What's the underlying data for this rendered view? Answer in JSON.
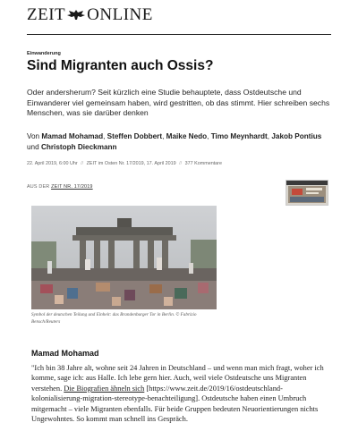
{
  "header": {
    "logo_left": "ZEIT",
    "logo_right": "ONLINE"
  },
  "article": {
    "kicker": "Einwanderung",
    "title": "Sind Migranten auch Ossis?",
    "intro": "Oder andersherum? Seit kürzlich eine Studie behauptete, dass Ostdeutsche und Einwanderer viel gemeinsam haben, wird gestritten, ob das stimmt. Hier schreiben sechs Menschen, was sie darüber denken",
    "authors_prefix": "Von ",
    "authors": [
      "Mamad Mohamad",
      "Steffen Dobbert",
      "Maike Nedo",
      "Timo Meynhardt",
      "Jakob Pontius",
      "Christoph Dieckmann"
    ],
    "authors_sep": ", ",
    "authors_and": " und ",
    "meta": {
      "date": "22. April 2019, 6:00 Uhr",
      "separator": "//",
      "source": "ZEIT im Osten Nr. 17/2019, 17. April 2019",
      "comments": "377 Kommentare"
    },
    "issue": {
      "prefix": "AUS DER",
      "link": "ZEIT NR. 17/2019"
    },
    "image_caption": "Symbol der deutschen Teilung und Einheit: das Brandenburger Tor in Berlin. © Fabrizio Bensch/Reuters",
    "section_heading": "Mamad Mohamad",
    "body": {
      "part1": "\"Ich bin 38 Jahre alt, wohne seit 24 Jahren in Deutschland – und wenn man mich fragt, woher ich komme, sage ich: aus Halle. Ich lebe gern hier. Auch, weil viele Ostdeutsche uns Migranten verstehen. ",
      "link_text": "Die Biografien ähneln sich",
      "link_url": "[https://www.zeit.de/2019/16/ostdeutschland-kolonialisierung-migration-stereotype-benachteiligung]",
      "part2": ". Ostdeutsche haben einen Umbruch mitgemacht – viele Migranten ebenfalls. Für beide Gruppen bedeuten Neuorientierungen nichts Ungewohntes. So kommt man schnell ins Gespräch."
    }
  }
}
